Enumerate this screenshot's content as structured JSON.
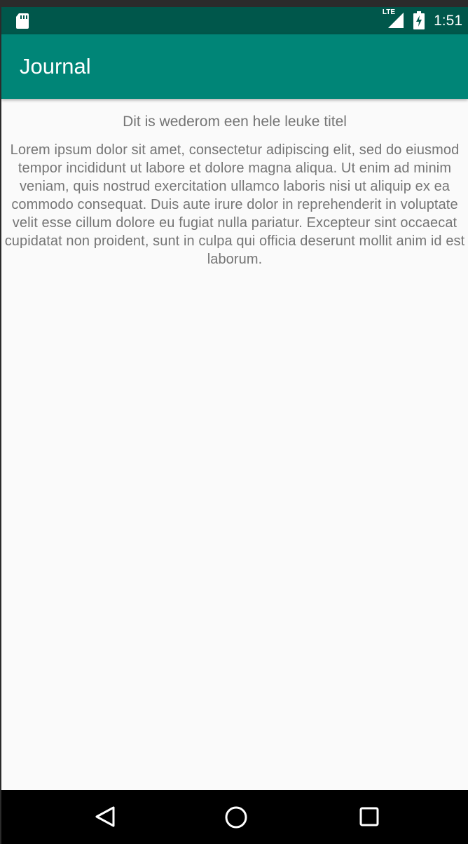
{
  "status_bar": {
    "network_label": "LTE",
    "time": "1:51",
    "icons": [
      "sd-card-icon",
      "signal-icon",
      "battery-charging-icon"
    ]
  },
  "app_bar": {
    "title": "Journal"
  },
  "entry": {
    "title": "Dit is wederom een hele leuke titel",
    "body": "Lorem ipsum dolor sit amet, consectetur adipiscing elit, sed do eiusmod tempor incididunt ut labore et dolore magna aliqua. Ut enim ad minim veniam, quis nostrud exercitation ullamco laboris nisi ut aliquip ex ea commodo consequat. Duis aute irure dolor in reprehenderit in voluptate velit esse cillum dolore eu fugiat nulla pariatur. Excepteur sint occaecat cupidatat non proident, sunt in culpa qui officia deserunt mollit anim id est laborum."
  },
  "nav_bar": {
    "buttons": [
      "back-icon",
      "home-icon",
      "recents-icon"
    ]
  },
  "colors": {
    "status_bar": "#00574b",
    "app_bar": "#008577",
    "background": "#fafafa",
    "text": "#757575"
  }
}
